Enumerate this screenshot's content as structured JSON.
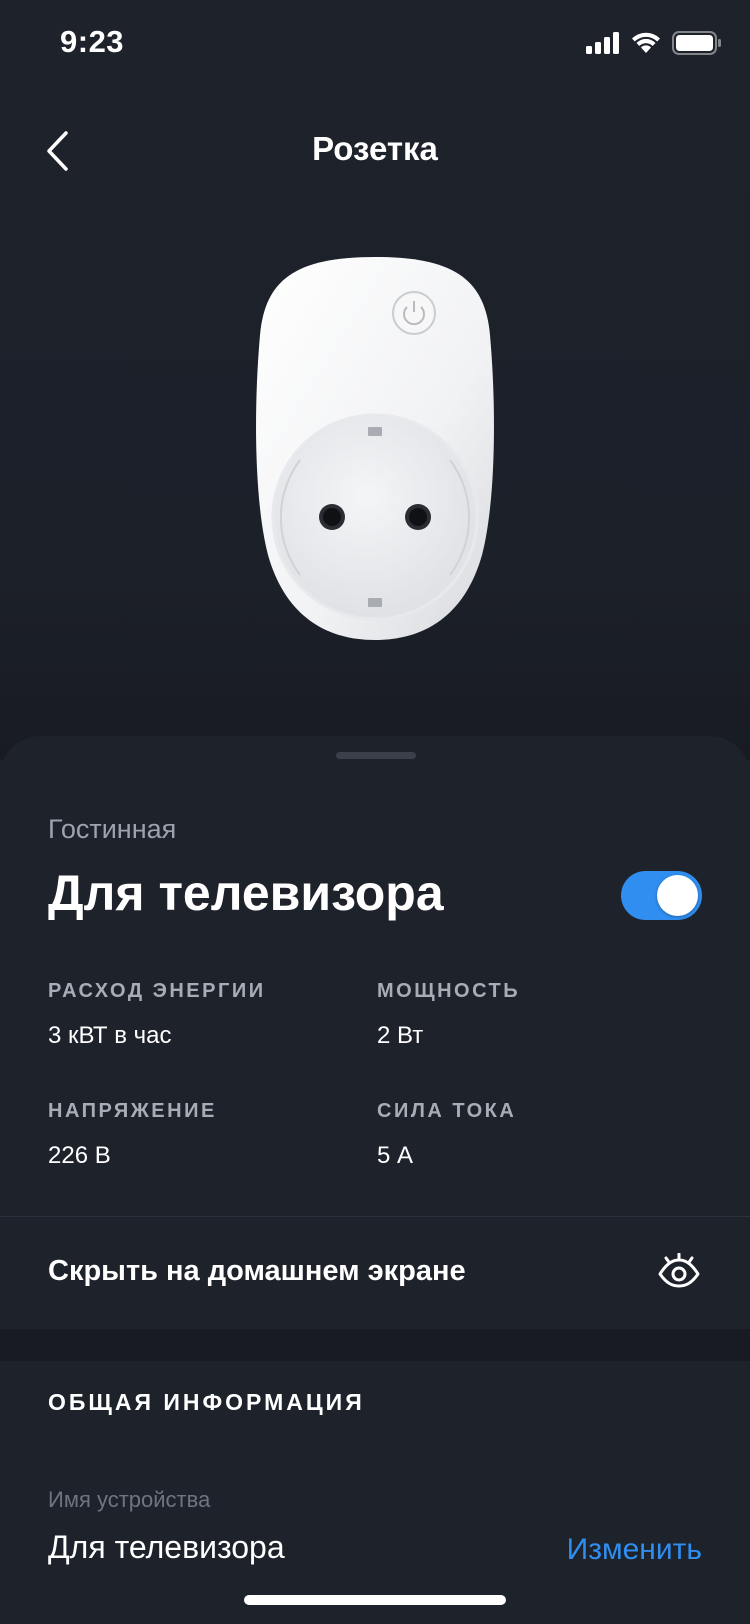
{
  "status_bar": {
    "time": "9:23",
    "icons": [
      "cellular-signal-icon",
      "wifi-icon",
      "battery-icon"
    ]
  },
  "nav": {
    "title": "Розетка",
    "back_icon": "chevron-left-icon"
  },
  "device": {
    "image": "smart-plug-image",
    "room": "Гостинная",
    "name": "Для телевизора",
    "power_on": true
  },
  "metrics": [
    {
      "label": "РАСХОД ЭНЕРГИИ",
      "value": "3 кВТ в час"
    },
    {
      "label": "МОЩНОСТЬ",
      "value": "2 Вт"
    },
    {
      "label": "НАПРЯЖЕНИЕ",
      "value": "226 В"
    },
    {
      "label": "СИЛА ТОКА",
      "value": "5 А"
    }
  ],
  "hide_row": {
    "label": "Скрыть на домашнем экране",
    "icon": "eye-icon"
  },
  "general_info": {
    "title": "ОБЩАЯ ИНФОРМАЦИЯ",
    "device_name_label": "Имя устройства",
    "device_name_value": "Для телевизора",
    "edit_label": "Изменить"
  },
  "colors": {
    "background": "#1e222b",
    "accent": "#2f8ef0",
    "muted_text": "#9da2ad"
  }
}
